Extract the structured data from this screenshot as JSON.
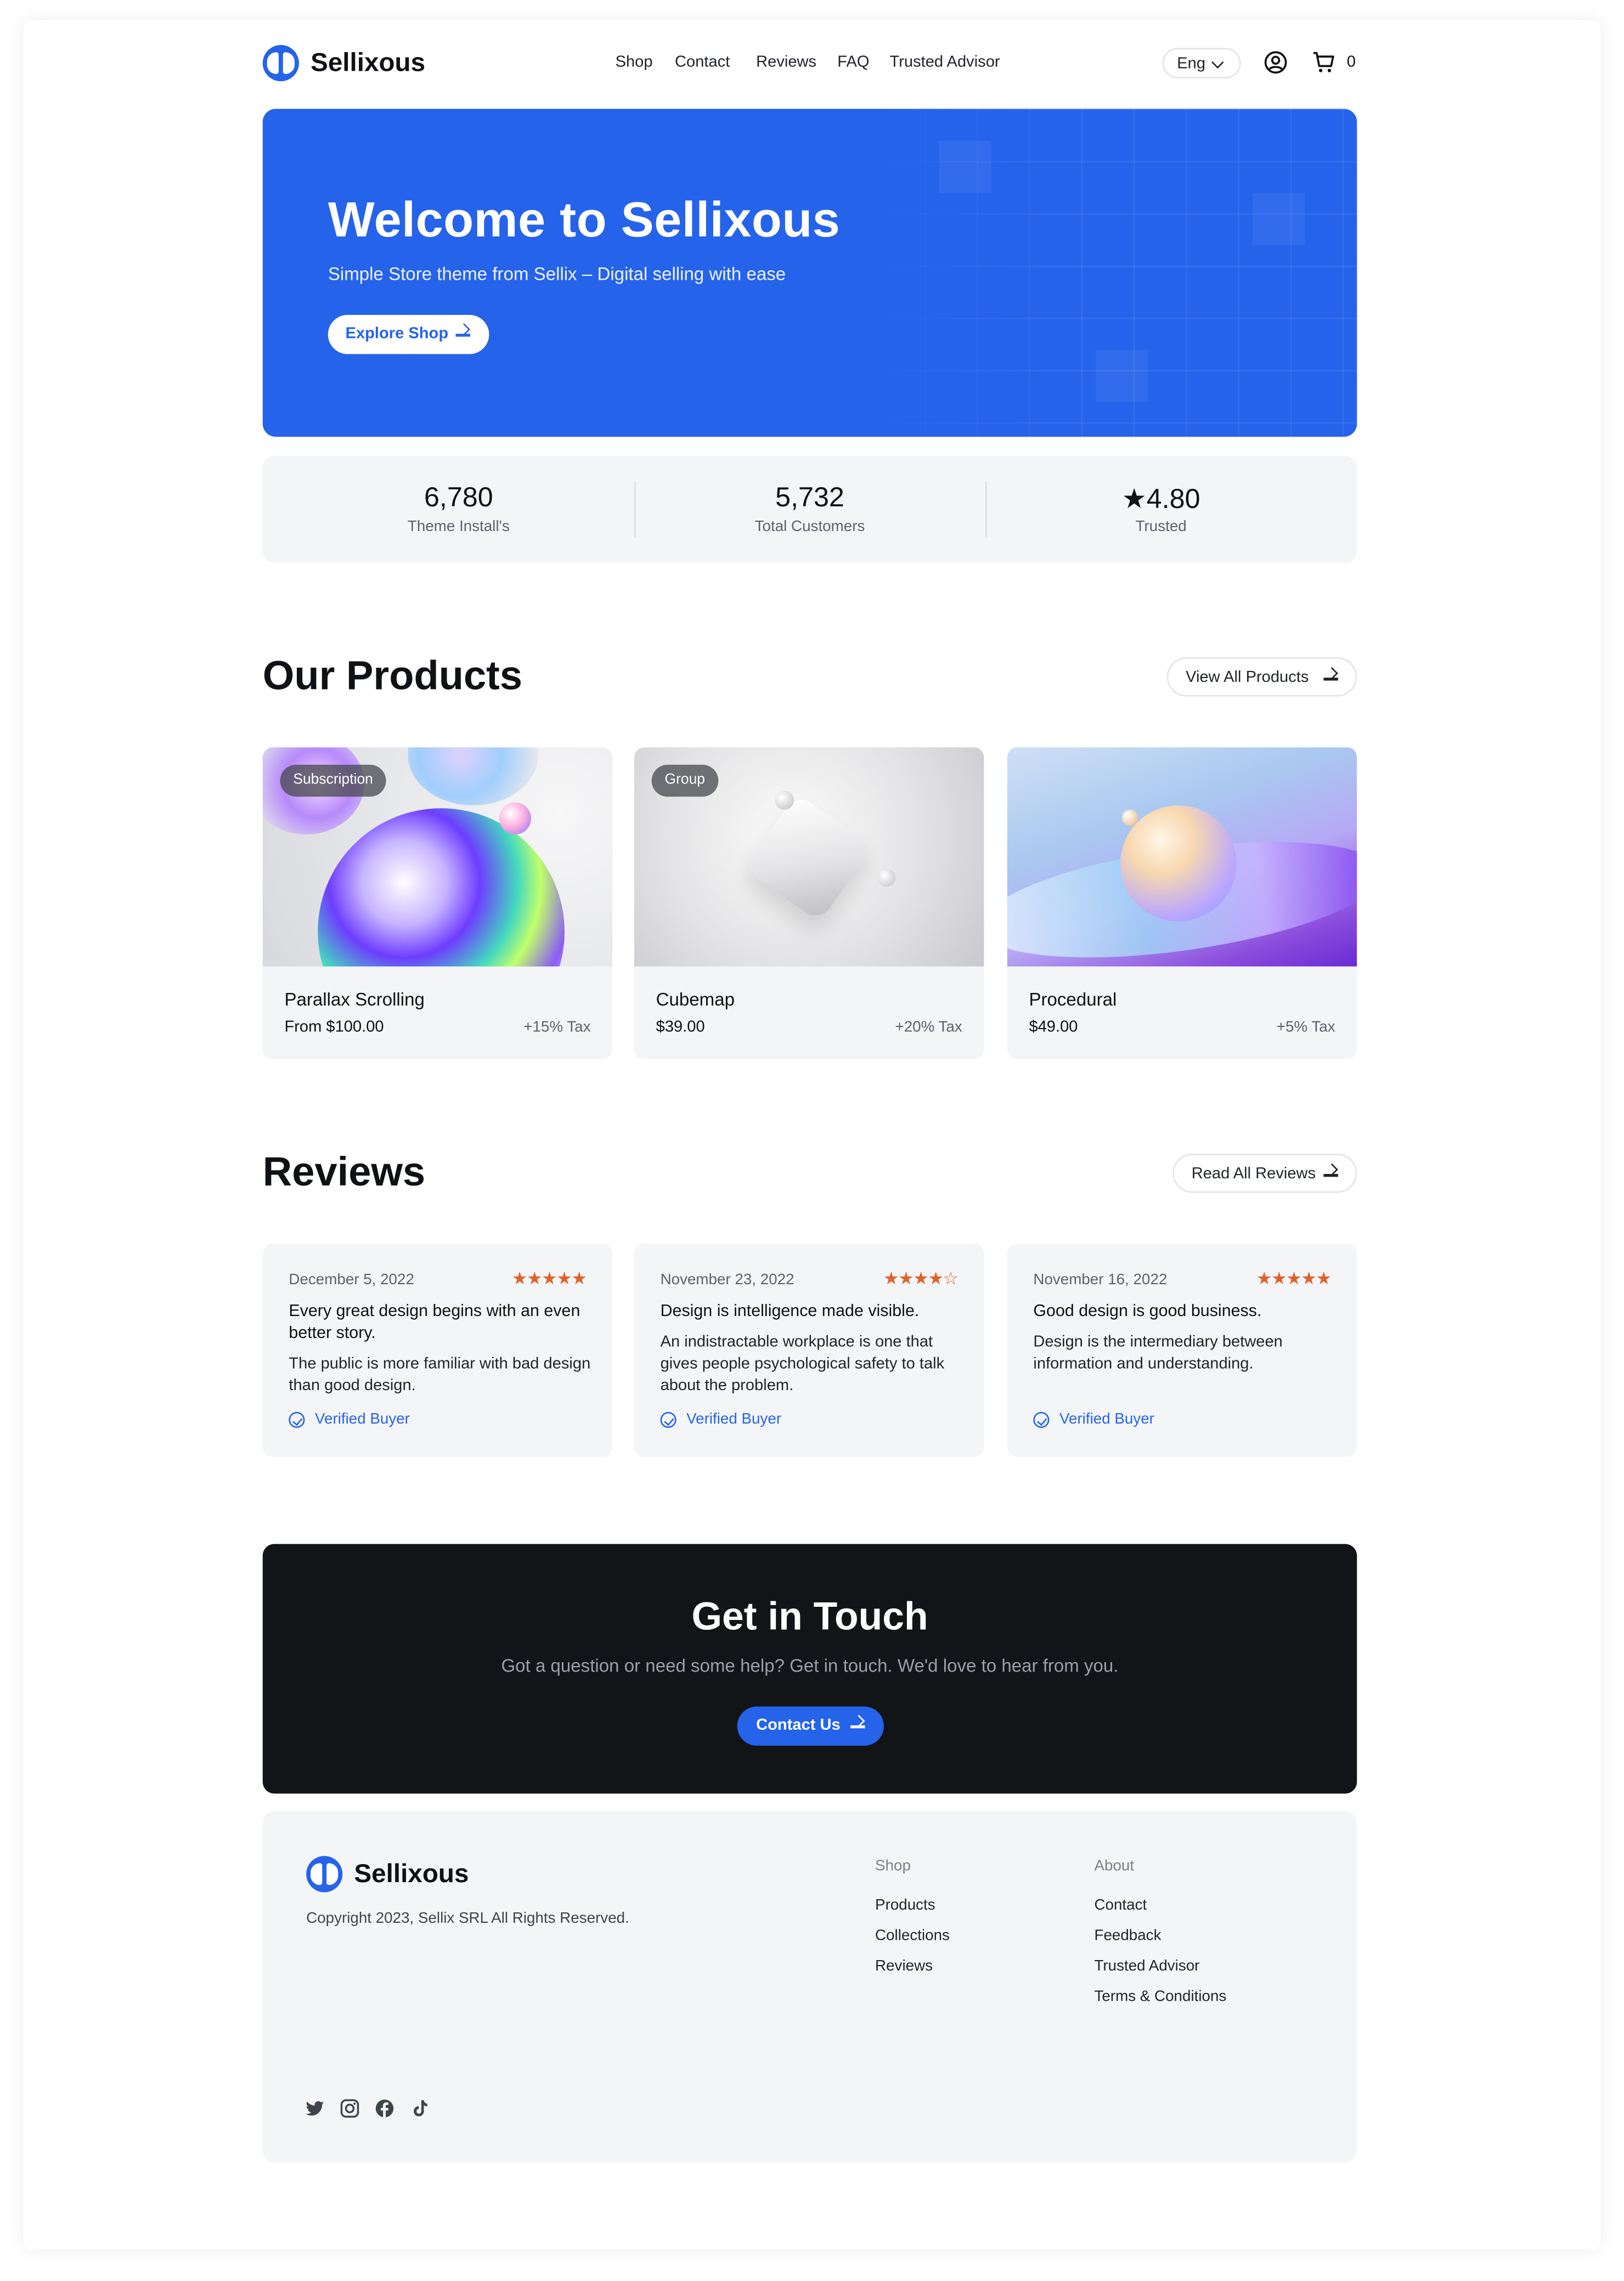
{
  "header": {
    "brand": "Sellixous",
    "nav": [
      "Shop",
      "Contact",
      "Reviews",
      "FAQ",
      "Trusted Advisor"
    ],
    "language": "Eng",
    "cart_count": "0",
    "icons": [
      "user-icon",
      "cart-icon",
      "chevron-down-icon"
    ]
  },
  "hero": {
    "title": "Welcome to Sellixous",
    "subtitle": "Simple Store theme from Sellix – Digital selling with ease",
    "cta": "Explore Shop"
  },
  "stats": [
    {
      "value": "6,780",
      "label": "Theme Install's"
    },
    {
      "value": "5,732",
      "label": "Total Customers"
    },
    {
      "value": "★4.80",
      "label": "Trusted"
    }
  ],
  "products": {
    "title": "Our Products",
    "view_all": "View All Products",
    "items": [
      {
        "badge": "Subscription",
        "name": "Parallax Scrolling",
        "price": "From $100.00",
        "tax": "+15% Tax"
      },
      {
        "badge": "Group",
        "name": "Cubemap",
        "price": "$39.00",
        "tax": "+20% Tax"
      },
      {
        "badge": "",
        "name": "Procedural",
        "price": "$49.00",
        "tax": "+5% Tax"
      }
    ]
  },
  "reviews": {
    "title": "Reviews",
    "read_all": "Read All Reviews",
    "items": [
      {
        "date": "December 5, 2022",
        "rating": 5,
        "title": "Every great design begins with an even better story.",
        "body": "The public is more familiar with bad design than good design.",
        "verified": "Verified Buyer"
      },
      {
        "date": "November 23, 2022",
        "rating": 4,
        "title": "Design is intelligence made visible.",
        "body": "An indistractable workplace is one that gives people psychological safety to talk about the problem.",
        "verified": "Verified Buyer"
      },
      {
        "date": "November 16, 2022",
        "rating": 5,
        "title": "Good design is good business.",
        "body": "Design is the intermediary between information and understanding.",
        "verified": "Verified Buyer"
      }
    ]
  },
  "contact": {
    "title": "Get in Touch",
    "text": "Got a question or need some help? Get in touch. We'd love to hear from you.",
    "cta": "Contact Us"
  },
  "footer": {
    "brand": "Sellixous",
    "copyright": "Copyright 2023, Sellix SRL All Rights Reserved.",
    "shop_heading": "Shop",
    "shop_links": [
      "Products",
      "Collections",
      "Reviews"
    ],
    "about_heading": "About",
    "about_links": [
      "Contact",
      "Feedback",
      "Trusted Advisor",
      "Terms & Conditions"
    ],
    "social": [
      "twitter-icon",
      "instagram-icon",
      "facebook-icon",
      "tiktok-icon"
    ]
  },
  "colors": {
    "accent": "#2563eb",
    "dark": "#131417",
    "star": "#e0622b",
    "surface": "#f4f5f7"
  }
}
